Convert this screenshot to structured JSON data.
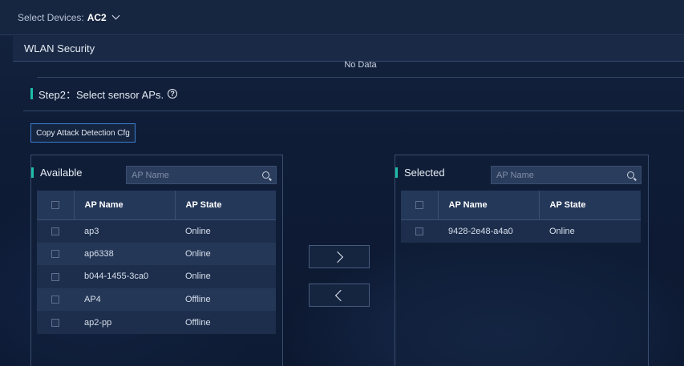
{
  "topbar": {
    "select_label": "Select Devices:",
    "device": "AC2"
  },
  "section": {
    "title": "WLAN Security",
    "no_data": "No Data"
  },
  "step": {
    "title": "Step2：Select sensor APs."
  },
  "copy_button": "Copy Attack Detection Cfg",
  "available": {
    "title": "Available",
    "search_placeholder": "AP Name",
    "columns": [
      "AP Name",
      "AP State"
    ],
    "rows": [
      {
        "name": "ap3",
        "state": "Online"
      },
      {
        "name": "ap6338",
        "state": "Online"
      },
      {
        "name": "b044-1455-3ca0",
        "state": "Online"
      },
      {
        "name": "AP4",
        "state": "Offline"
      },
      {
        "name": "ap2-pp",
        "state": "Offline"
      }
    ]
  },
  "selected": {
    "title": "Selected",
    "search_placeholder": "AP Name",
    "columns": [
      "AP Name",
      "AP State"
    ],
    "rows": [
      {
        "name": "9428-2e48-a4a0",
        "state": "Online"
      }
    ]
  },
  "colors": {
    "accent": "#1dbda8",
    "button_border": "#3d7fd1",
    "background": "#101d35"
  },
  "icons": [
    "chevron-down-icon",
    "help-icon",
    "search-icon",
    "chevron-right-icon",
    "chevron-left-icon"
  ]
}
